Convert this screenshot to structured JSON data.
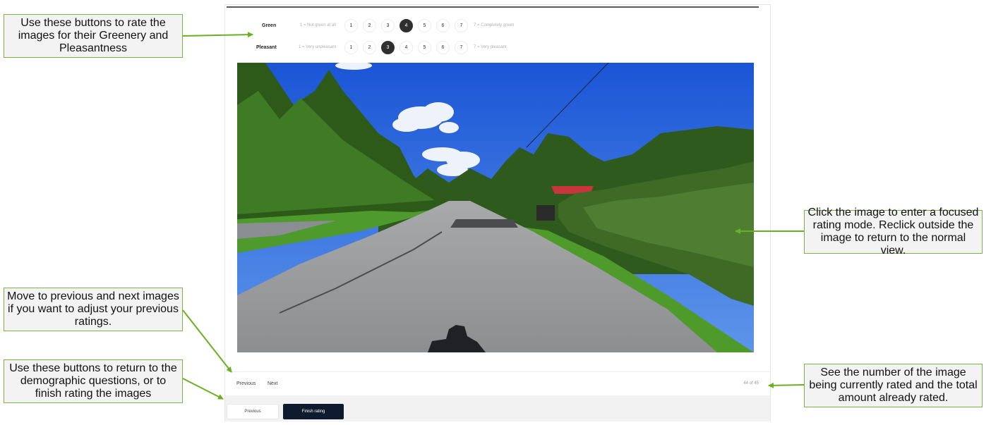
{
  "ratings": {
    "green": {
      "label": "Green",
      "min_label": "1 = Not green at all",
      "max_label": "7 = Completely green",
      "options": [
        "1",
        "2",
        "3",
        "4",
        "5",
        "6",
        "7"
      ],
      "selected": "4"
    },
    "pleasant": {
      "label": "Pleasant",
      "min_label": "1 = Very unpleasant",
      "max_label": "7 = Very pleasant",
      "options": [
        "1",
        "2",
        "3",
        "4",
        "5",
        "6",
        "7"
      ],
      "selected": "3"
    }
  },
  "navigation": {
    "previous_label": "Previous",
    "next_label": "Next",
    "counter": "44 of 45"
  },
  "footer": {
    "previous_button": "Previous",
    "finish_button": "Finish rating"
  },
  "annotations": {
    "rate_buttons": "Use these buttons to rate the images for their Greenery and Pleasantness",
    "focus_mode": "Click the image to enter a focused rating mode. Reclick outside the image to return to the normal view.",
    "prev_next": "Move to previous and next images if you want to adjust your previous ratings.",
    "return_finish": "Use these buttons to return to the demographic questions, or to finish rating the images",
    "counter_hint": "See the number of the image being currently rated and the total amount already rated."
  },
  "colors": {
    "selected_circle": "#2f2f2f",
    "finish_button": "#0e1a2e",
    "callout_border": "#7cb342",
    "arrow": "#6ab023"
  }
}
